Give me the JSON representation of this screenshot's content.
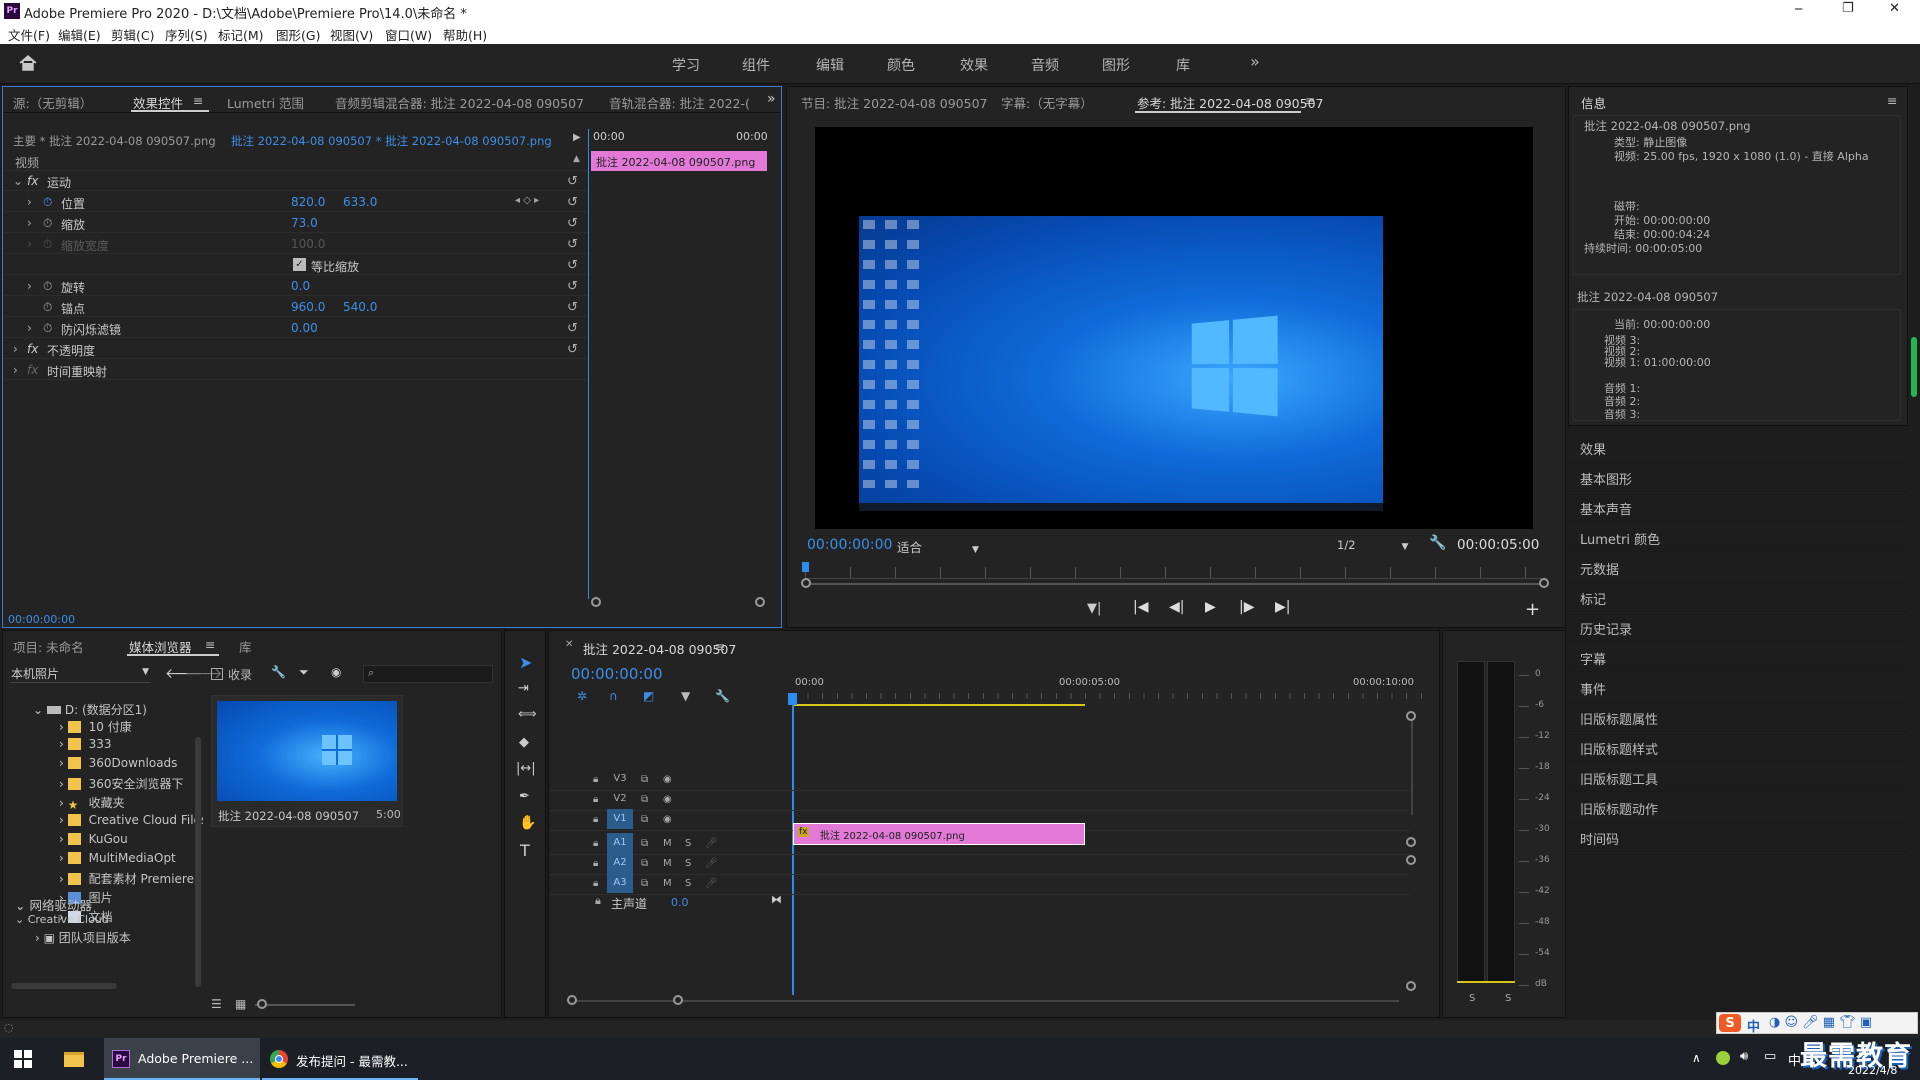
{
  "window": {
    "title": "Adobe Premiere Pro 2020 - D:\\文档\\Adobe\\Premiere Pro\\14.0\\未命名 *",
    "app_icon_label": "Pr",
    "minimize": "─",
    "maximize": "❐",
    "close": "✕"
  },
  "menu": [
    "文件(F)",
    "编辑(E)",
    "剪辑(C)",
    "序列(S)",
    "标记(M)",
    "图形(G)",
    "视图(V)",
    "窗口(W)",
    "帮助(H)"
  ],
  "workspaces": [
    "学习",
    "组件",
    "编辑",
    "颜色",
    "效果",
    "音频",
    "图形",
    "库"
  ],
  "workspace_more": "»",
  "source_panel": {
    "tabs": [
      "源:（无剪辑）",
      "效果控件",
      "Lumetri 范围",
      "音频剪辑混合器: 批注 2022-04-08 090507",
      "音轨混合器: 批注 2022-("
    ],
    "active_tab": "效果控件",
    "header": {
      "master": "主要 * 批注 2022-04-08 090507.png",
      "clip": "批注 2022-04-08 090507 * 批注 2022-04-08 090507.png",
      "t0": "00:00",
      "t1": "00:00",
      "clip_bar": "批注 2022-04-08 090507.png"
    },
    "section_video": "视频",
    "fx_motion": "运动",
    "position": {
      "label": "位置",
      "x": "820.0",
      "y": "633.0"
    },
    "scale": {
      "label": "缩放",
      "value": "73.0"
    },
    "scale_width": {
      "label": "缩放宽度",
      "value": "100.0"
    },
    "uniform": {
      "label": "等比缩放"
    },
    "rotation": {
      "label": "旋转",
      "value": "0.0"
    },
    "anchor": {
      "label": "锚点",
      "x": "960.0",
      "y": "540.0"
    },
    "anti_flicker": {
      "label": "防闪烁滤镜",
      "value": "0.00"
    },
    "opacity": "不透明度",
    "time_remap": "时间重映射",
    "footer_time": "00:00:00:00"
  },
  "program_panel": {
    "tabs": [
      "节目: 批注 2022-04-08 090507",
      "字幕:（无字幕）",
      "参考: 批注 2022-04-08 090507"
    ],
    "active_tab": "参考: 批注 2022-04-08 090507",
    "timecode": "00:00:00:00",
    "fit": "适合",
    "quality": "1/2",
    "duration": "00:00:05:00"
  },
  "info_panel": {
    "title": "信息",
    "file": "批注 2022-04-08 090507.png",
    "type_row": "类型:  静止图像",
    "video_row": "视频:  25.00 fps, 1920 x 1080 (1.0) - 直接 Alpha",
    "tape_row": "磁带:",
    "in_row": "开始:  00:00:00:00",
    "out_row": "结束:  00:00:04:24",
    "dur_row": "持续时间:  00:00:05:00",
    "seq_title": "批注 2022-04-08 090507",
    "current_row": "当前:  00:00:00:00",
    "v3_row": "视频 3:",
    "v2_row": "视频 2:",
    "v1_row": "视频 1:  01:00:00:00",
    "a1_row": "音频 1:",
    "a2_row": "音频 2:",
    "a3_row": "音频 3:"
  },
  "side_panels": [
    "效果",
    "基本图形",
    "基本声音",
    "Lumetri 颜色",
    "元数据",
    "标记",
    "历史记录",
    "字幕",
    "事件",
    "旧版标题属性",
    "旧版标题样式",
    "旧版标题工具",
    "旧版标题动作",
    "时间码"
  ],
  "project_panel": {
    "tabs": [
      "项目: 未命名",
      "媒体浏览器",
      "库"
    ],
    "active_tab": "媒体浏览器",
    "location": "本机照片",
    "collect": "收录",
    "drive": "D: (数据分区1)",
    "thumb_name": "批注 2022-04-08 090507",
    "thumb_dur": "5:00",
    "network": "网络驱动器",
    "cloud": "Creative Cloud",
    "team": "团队项目版本",
    "folders": [
      "10 付康",
      "333",
      "360Downloads",
      "360安全浏览器下",
      "收藏夹",
      "Creative Cloud Files",
      "KuGou",
      "MultiMediaOpt",
      "配套素材 Premiere",
      "图片",
      "文档"
    ]
  },
  "timeline": {
    "tab": "批注 2022-04-08 090507",
    "timecode": "00:00:00:00",
    "ruler": [
      "00:00",
      "00:00:05:00",
      "00:00:10:00"
    ],
    "tracks": [
      {
        "name": "V3"
      },
      {
        "name": "V2"
      },
      {
        "name": "V1"
      },
      {
        "name": "A1"
      },
      {
        "name": "A2"
      },
      {
        "name": "A3"
      }
    ],
    "clip": "批注 2022-04-08 090507.png",
    "master": "主声道",
    "master_val": "0.0",
    "mute": "M",
    "solo": "S",
    "fx_badge": "fx"
  },
  "meter": {
    "scale": [
      "0",
      "-6",
      "-12",
      "-18",
      "-24",
      "-30",
      "-36",
      "-42",
      "-48",
      "-54",
      "dB"
    ],
    "solo_l": "S",
    "solo_r": "S"
  },
  "taskbar": {
    "items": [
      "Adobe Premiere ...",
      "发布提问 - 最需教..."
    ],
    "ime": "中",
    "date": "2022/4/8",
    "watermark": "最需教育"
  },
  "colors": {
    "accent": "#2d8ceb",
    "clip_pink": "#e279d6",
    "timeline_yellow": "#d6c61a",
    "v1_highlight": "#2b5d8c"
  }
}
